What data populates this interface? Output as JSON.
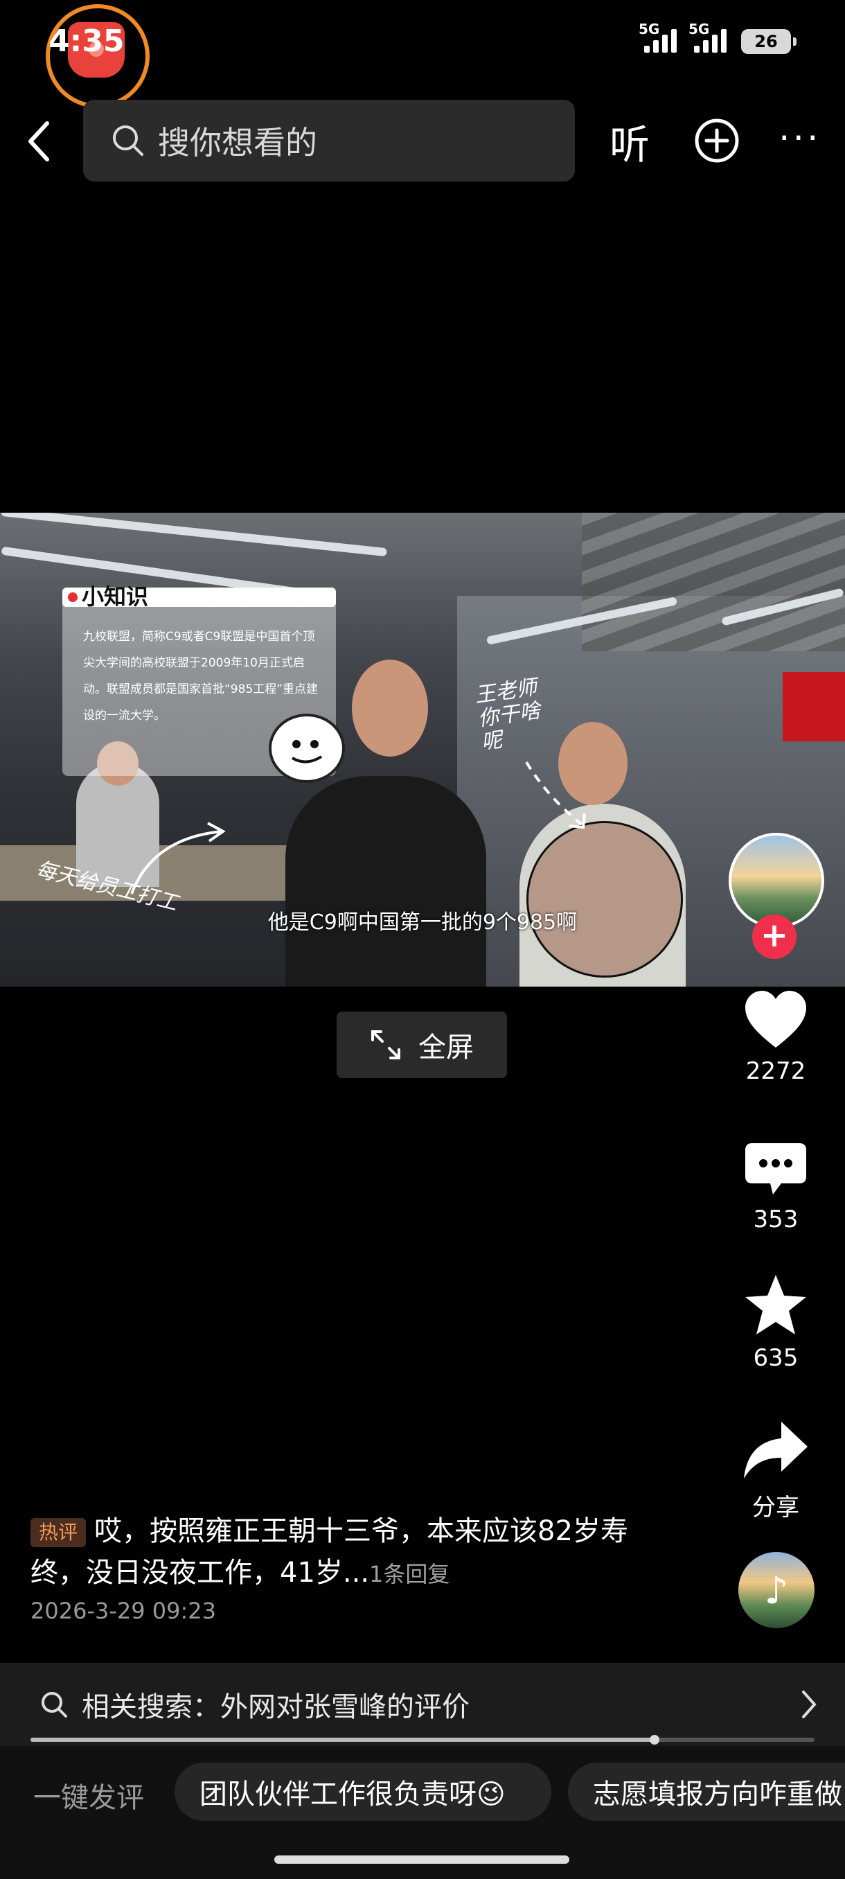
{
  "status": {
    "time": "4:35",
    "network1": "5G",
    "network2": "5G",
    "battery": "26"
  },
  "topbar": {
    "search_placeholder": "搜你想看的",
    "listen_label": "听"
  },
  "video": {
    "info_title": "小知识",
    "info_text": "九校联盟，简称C9或者C9联盟是中国首个顶尖大学间的高校联盟于2009年10月正式启动。联盟成员都是国家首批“985工程”重点建设的一流大学。",
    "hand_text_left": "每天给员工打工",
    "hand_text_right": "王老师你干啥呢",
    "subtitle": "他是C9啊中国第一批的9个985啊"
  },
  "fullscreen": {
    "label": "全屏"
  },
  "rail": {
    "likes": "2272",
    "comments": "353",
    "favorites": "635",
    "share": "分享"
  },
  "comment": {
    "tag": "热评",
    "text": "哎，按照雍正王朝十三爷，本来应该82岁寿终，没日没夜工作，41岁...",
    "reply": "1条回复",
    "time": "2026-3-29 09:23"
  },
  "related": {
    "text": "相关搜索：外网对张雪峰的评价"
  },
  "playback": {
    "progress": 0.796
  },
  "bottom": {
    "one_key": "一键发评",
    "chip1": "团队伙伴工作很负责呀😉",
    "chip2": "志愿填报方向咋重做"
  }
}
